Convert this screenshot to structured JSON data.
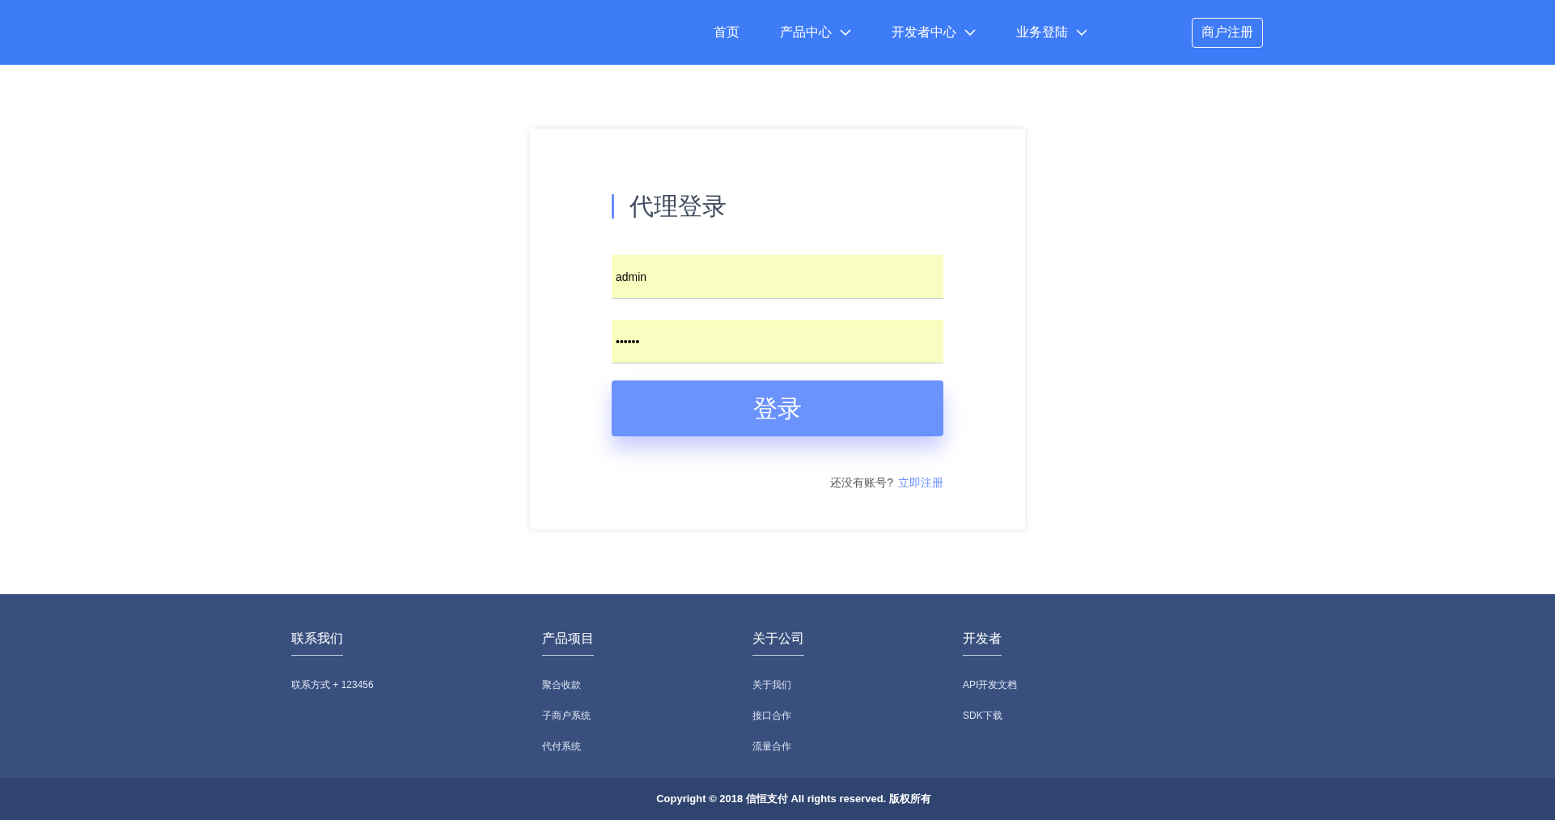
{
  "nav": {
    "items": [
      {
        "label": "首页",
        "kind": "link"
      },
      {
        "label": "产品中心",
        "kind": "dropdown"
      },
      {
        "label": "开发者中心",
        "kind": "dropdown"
      },
      {
        "label": "业务登陆",
        "kind": "dropdown"
      }
    ],
    "register_button": "商户注册"
  },
  "login": {
    "title": "代理登录",
    "username": {
      "value": "admin"
    },
    "password": {
      "value": "••••••"
    },
    "submit": "登录",
    "signup_prompt": "还没有账号?",
    "signup_link": "立即注册"
  },
  "footer": {
    "columns": [
      {
        "heading": "联系我们",
        "links": [
          "联系方式 + 123456"
        ]
      },
      {
        "heading": "产品项目",
        "links": [
          "聚合收款",
          "子商户系统",
          "代付系统"
        ]
      },
      {
        "heading": "关于公司",
        "links": [
          "关于我们",
          "接口合作",
          "流量合作"
        ]
      },
      {
        "heading": "开发者",
        "links": [
          "API开发文档",
          "SDK下载"
        ]
      }
    ],
    "copyright": "Copyright © 2018 信恒支付 All rights reserved. 版权所有"
  }
}
